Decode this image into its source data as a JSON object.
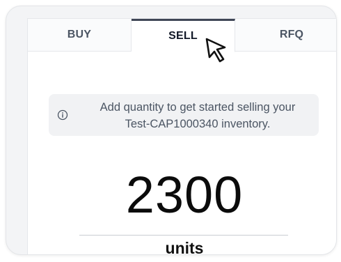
{
  "tabs": [
    {
      "label": "BUY",
      "active": false
    },
    {
      "label": "SELL",
      "active": true
    },
    {
      "label": "RFQ",
      "active": false
    }
  ],
  "banner": {
    "icon": "info-icon",
    "line1": "Add quantity to get started selling your",
    "line2": "Test-CAP1000340 inventory."
  },
  "quantity": {
    "value": "2300",
    "unit": "units"
  },
  "cursor": {
    "icon": "pointer-arrow-icon"
  },
  "colors": {
    "active_tab_indicator": "#3f4656",
    "banner_bg": "#f1f2f4",
    "text_primary": "#111827",
    "text_secondary": "#4b5563"
  }
}
